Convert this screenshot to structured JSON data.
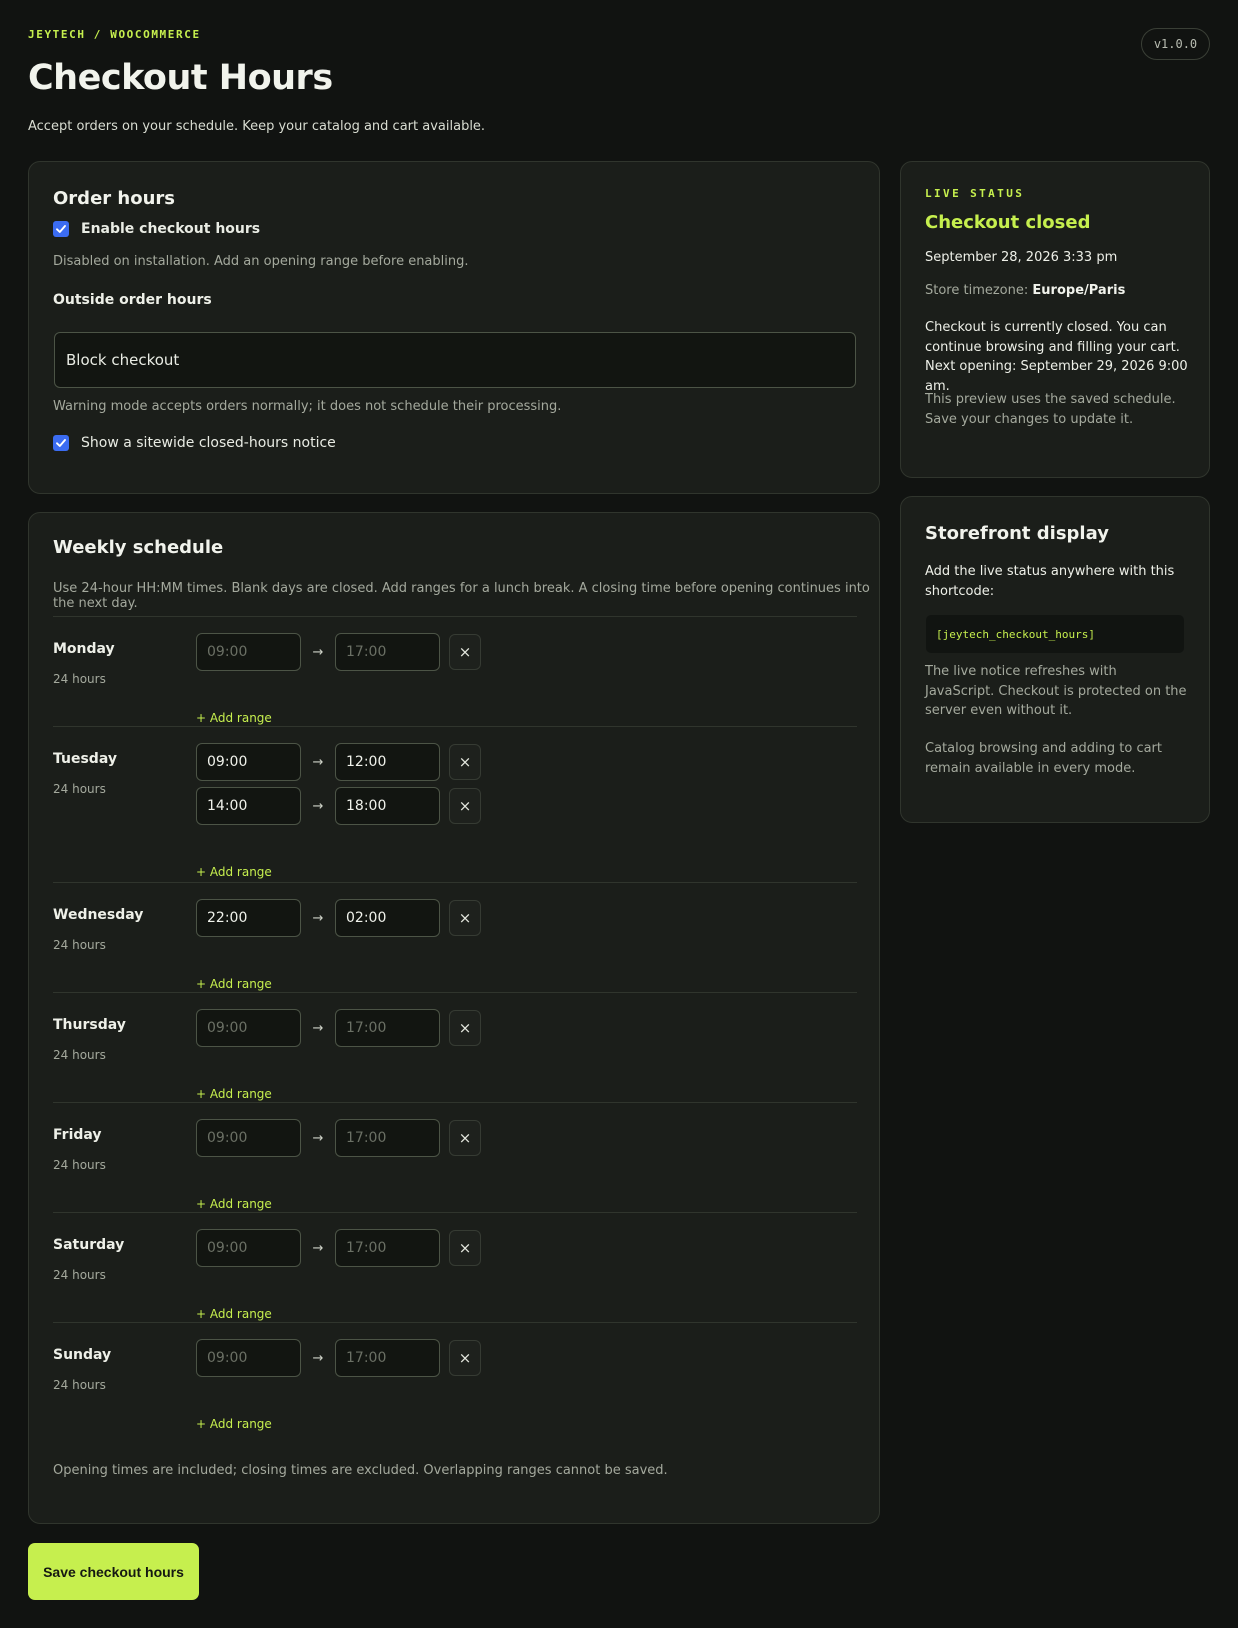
{
  "header": {
    "brand": "JEYTECH / WOOCOMMERCE",
    "version": "v1.0.0",
    "title": "Checkout Hours",
    "subtitle": "Accept orders on your schedule. Keep your catalog and cart available."
  },
  "order_hours": {
    "title": "Order hours",
    "enable_label": "Enable checkout hours",
    "enable_checked": true,
    "enable_help": "Disabled on installation. Add an opening range before enabling.",
    "outside_label": "Outside order hours",
    "outside_value": "Block checkout",
    "outside_help": "Warning mode accepts orders normally; it does not schedule their processing.",
    "notice_label": "Show a sitewide closed-hours notice",
    "notice_checked": true
  },
  "schedule": {
    "title": "Weekly schedule",
    "help": "Use 24-hour HH:MM times. Blank days are closed. Add ranges for a lunch break. A closing time before opening continues into the next day.",
    "add_range_label": "+ Add range",
    "remove_glyph": "×",
    "arrow_glyph": "→",
    "days": [
      {
        "name": "Monday",
        "hours": "24 hours",
        "ranges": [
          {
            "open": "",
            "close": "",
            "open_placeholder": "09:00",
            "close_placeholder": "17:00"
          }
        ]
      },
      {
        "name": "Tuesday",
        "hours": "24 hours",
        "ranges": [
          {
            "open": "09:00",
            "close": "12:00"
          },
          {
            "open": "14:00",
            "close": "18:00"
          }
        ]
      },
      {
        "name": "Wednesday",
        "hours": "24 hours",
        "ranges": [
          {
            "open": "22:00",
            "close": "02:00"
          }
        ]
      },
      {
        "name": "Thursday",
        "hours": "24 hours",
        "ranges": [
          {
            "open": "",
            "close": "",
            "open_placeholder": "09:00",
            "close_placeholder": "17:00"
          }
        ]
      },
      {
        "name": "Friday",
        "hours": "24 hours",
        "ranges": [
          {
            "open": "",
            "close": "",
            "open_placeholder": "09:00",
            "close_placeholder": "17:00"
          }
        ]
      },
      {
        "name": "Saturday",
        "hours": "24 hours",
        "ranges": [
          {
            "open": "",
            "close": "",
            "open_placeholder": "09:00",
            "close_placeholder": "17:00"
          }
        ]
      },
      {
        "name": "Sunday",
        "hours": "24 hours",
        "ranges": [
          {
            "open": "",
            "close": "",
            "open_placeholder": "09:00",
            "close_placeholder": "17:00"
          }
        ]
      }
    ],
    "footer": "Opening times are included; closing times are excluded. Overlapping ranges cannot be saved."
  },
  "save_label": "Save checkout hours",
  "live_status": {
    "eyebrow": "LIVE STATUS",
    "state": "Checkout closed",
    "datetime": "September 28, 2026 3:33 pm",
    "timezone_label": "Store timezone:",
    "timezone_value": "Europe/Paris",
    "message": "Checkout is currently closed. You can continue browsing and filling your cart. Next opening: September 29, 2026 9:00 am.",
    "preview_note": "This preview uses the saved schedule. Save your changes to update it."
  },
  "storefront": {
    "title": "Storefront display",
    "intro": "Add the live status anywhere with this shortcode:",
    "shortcode": "[jeytech_checkout_hours]",
    "note1": "The live notice refreshes with JavaScript. Checkout is protected on the server even without it.",
    "note2": "Catalog browsing and adding to cart remain available in every mode."
  },
  "colors": {
    "background": "#111311",
    "card": "#1b1e1a",
    "accent": "#c6ef4e",
    "checkbox": "#3b6cf2"
  }
}
